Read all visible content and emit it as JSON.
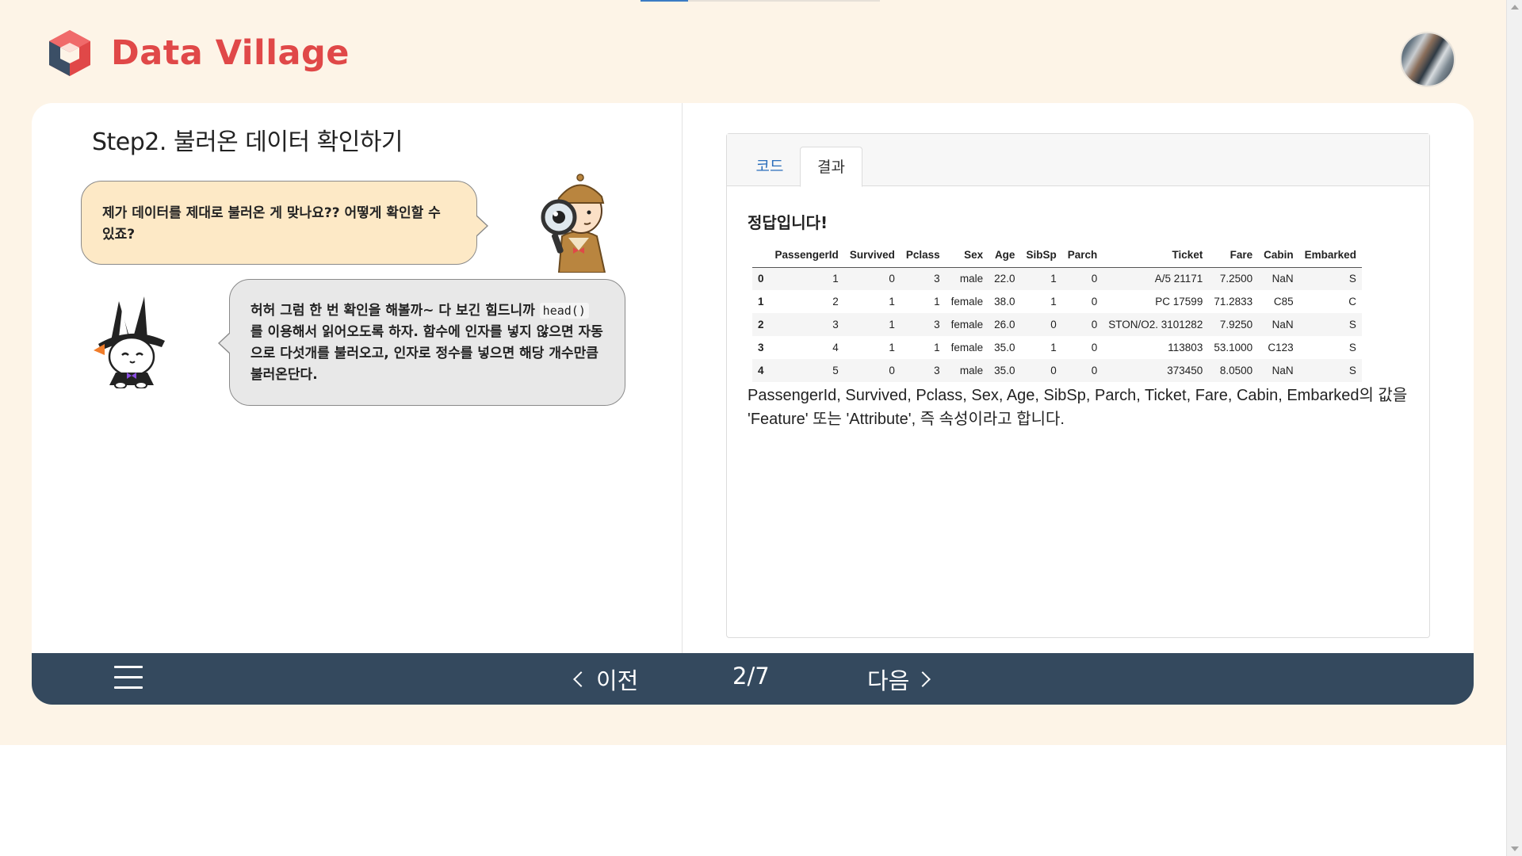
{
  "app": {
    "title": "Data Village",
    "brand_color": "#e04848"
  },
  "header": {
    "logo_icon": "cube-logo-icon",
    "avatar": "user-avatar"
  },
  "lesson": {
    "step_title": "Step2. 불러온 데이터 확인하기",
    "bubble_student": "제가 데이터를 제대로 불러온 게 맞나요?? 어떻게 확인할 수 있죠?",
    "bubble_teacher_before": "허허 그럼 한 번 확인을 해볼까~ 다 보긴 힘드니까 ",
    "bubble_teacher_code": "head()",
    "bubble_teacher_after": " 를 이용해서 읽어오도록 하자. 함수에 인자를 넣지 않으면 자동으로 다섯개를 불러오고, 인자로 정수를 넣으면 해당 개수만큼 불러온단다."
  },
  "result_panel": {
    "tabs": [
      {
        "label": "코드",
        "active": false
      },
      {
        "label": "결과",
        "active": true
      }
    ],
    "answer_title": "정답입니다!",
    "table": {
      "columns": [
        "",
        "PassengerId",
        "Survived",
        "Pclass",
        "Sex",
        "Age",
        "SibSp",
        "Parch",
        "Ticket",
        "Fare",
        "Cabin",
        "Embarked"
      ],
      "rows": [
        [
          "0",
          "1",
          "0",
          "3",
          "male",
          "22.0",
          "1",
          "0",
          "A/5 21171",
          "7.2500",
          "NaN",
          "S"
        ],
        [
          "1",
          "2",
          "1",
          "1",
          "female",
          "38.0",
          "1",
          "0",
          "PC 17599",
          "71.2833",
          "C85",
          "C"
        ],
        [
          "2",
          "3",
          "1",
          "3",
          "female",
          "26.0",
          "0",
          "0",
          "STON/O2. 3101282",
          "7.9250",
          "NaN",
          "S"
        ],
        [
          "3",
          "4",
          "1",
          "1",
          "female",
          "35.0",
          "1",
          "0",
          "113803",
          "53.1000",
          "C123",
          "S"
        ],
        [
          "4",
          "5",
          "0",
          "3",
          "male",
          "35.0",
          "0",
          "0",
          "373450",
          "8.0500",
          "NaN",
          "S"
        ]
      ]
    },
    "description": "PassengerId, Survived, Pclass, Sex, Age, SibSp, Parch, Ticket, Fare, Cabin, Embarked의 값을 'Feature' 또는 'Attribute', 즉 속성이라고 합니다."
  },
  "footer": {
    "menu_icon": "hamburger-menu-icon",
    "prev_label": "이전",
    "page_indicator": "2/7",
    "next_label": "다음"
  }
}
